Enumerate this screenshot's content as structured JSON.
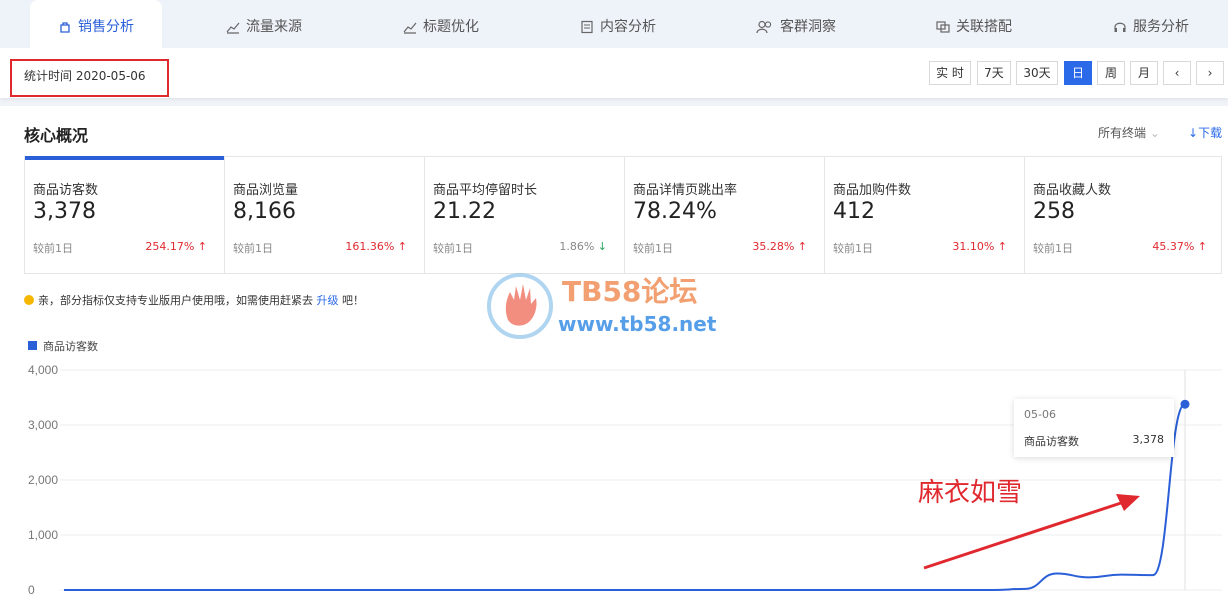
{
  "tabs": [
    {
      "label": "销售分析",
      "icon": "bag-icon",
      "active": true
    },
    {
      "label": "流量来源",
      "icon": "trend-icon"
    },
    {
      "label": "标题优化",
      "icon": "trend-icon"
    },
    {
      "label": "内容分析",
      "icon": "doc-icon"
    },
    {
      "label": "客群洞察",
      "icon": "users-icon"
    },
    {
      "label": "关联搭配",
      "icon": "link-icon"
    },
    {
      "label": "服务分析",
      "icon": "headset-icon"
    }
  ],
  "date": {
    "stat_time": "统计时间 2020-05-06"
  },
  "periods": [
    "实 时",
    "7天",
    "30天",
    "日",
    "周",
    "月"
  ],
  "active_period": "日",
  "core": {
    "title": "核心概况",
    "terminal": "所有终端",
    "download": "下载"
  },
  "metrics": [
    {
      "label": "商品访客数",
      "value": "3,378",
      "compare": "较前1日",
      "change": "254.17%",
      "dir": "up"
    },
    {
      "label": "商品浏览量",
      "value": "8,166",
      "compare": "较前1日",
      "change": "161.36%",
      "dir": "up"
    },
    {
      "label": "商品平均停留时长",
      "value": "21.22",
      "compare": "较前1日",
      "change": "1.86%",
      "dir": "down"
    },
    {
      "label": "商品详情页跳出率",
      "value": "78.24%",
      "compare": "较前1日",
      "change": "35.28%",
      "dir": "up"
    },
    {
      "label": "商品加购件数",
      "value": "412",
      "compare": "较前1日",
      "change": "31.10%",
      "dir": "up"
    },
    {
      "label": "商品收藏人数",
      "value": "258",
      "compare": "较前1日",
      "change": "45.37%",
      "dir": "up"
    }
  ],
  "notice": {
    "text": "亲，部分指标仅支持专业版用户使用哦，如需使用赶紧去",
    "link": "升级",
    "suffix": "吧！"
  },
  "watermark": {
    "title": "TB58论坛",
    "url": "www.tb58.net"
  },
  "tooltip": {
    "date": "05-06",
    "label": "商品访客数",
    "value": "3,378"
  },
  "annotation": "麻衣如雪",
  "colors": {
    "accent": "#2a5fd8",
    "up": "#e0292f",
    "down": "#2aa55a"
  },
  "chart_data": {
    "type": "line",
    "series": [
      {
        "name": "商品访客数",
        "values": [
          0,
          0,
          0,
          0,
          0,
          0,
          0,
          0,
          0,
          0,
          0,
          0,
          0,
          0,
          0,
          0,
          0,
          0,
          0,
          0,
          0,
          0,
          0,
          0,
          0,
          0,
          0,
          0,
          0,
          0,
          20,
          300,
          230,
          280,
          270,
          3378
        ]
      }
    ],
    "ylim": [
      0,
      4000
    ],
    "yticks": [
      "4,000",
      "3,000",
      "2,000",
      "1,000",
      "0"
    ],
    "grid": true
  }
}
